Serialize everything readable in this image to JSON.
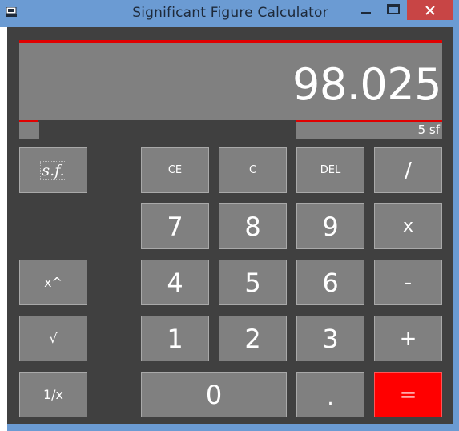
{
  "window": {
    "title": "Significant Figure Calculator",
    "colors": {
      "frame": "#6b9bd3",
      "close": "#c84545",
      "client": "#404040",
      "display": "#808080",
      "accent": "#e00000",
      "equals": "#ff0000"
    }
  },
  "display": {
    "result": "98.025",
    "sig_figs": "5 sf"
  },
  "side_buttons": {
    "sf": "s.f.",
    "power": "x^",
    "sqrt": "√",
    "reciprocal": "1/x"
  },
  "keypad": {
    "ce": "CE",
    "c": "C",
    "del": "DEL",
    "divide": "/",
    "seven": "7",
    "eight": "8",
    "nine": "9",
    "multiply": "x",
    "four": "4",
    "five": "5",
    "six": "6",
    "subtract": "-",
    "one": "1",
    "two": "2",
    "three": "3",
    "add": "+",
    "zero": "0",
    "decimal": ".",
    "equals": "="
  }
}
